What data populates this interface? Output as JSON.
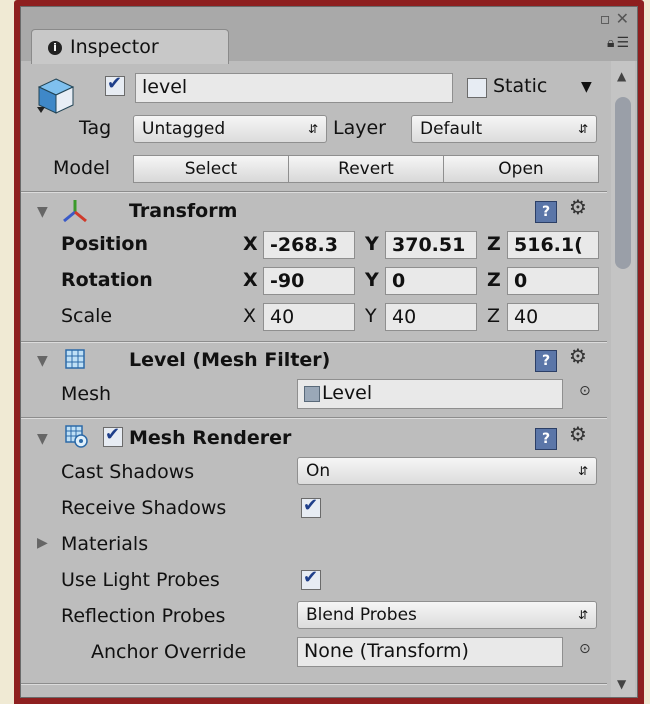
{
  "window": {
    "tab_title": "Inspector"
  },
  "object": {
    "active": true,
    "name": "level",
    "static_label": "Static",
    "tag_label": "Tag",
    "tag_value": "Untagged",
    "layer_label": "Layer",
    "layer_value": "Default",
    "model_label": "Model",
    "model_buttons": [
      "Select",
      "Revert",
      "Open"
    ]
  },
  "transform": {
    "title": "Transform",
    "rows": [
      {
        "label": "Position",
        "x": "-268.3",
        "y": "370.51",
        "z": "516.1("
      },
      {
        "label": "Rotation",
        "x": "-90",
        "y": "0",
        "z": "0"
      },
      {
        "label": "Scale",
        "x": "40",
        "y": "40",
        "z": "40"
      }
    ],
    "axis": [
      "X",
      "Y",
      "Z"
    ]
  },
  "mesh_filter": {
    "title": "Level (Mesh Filter)",
    "mesh_label": "Mesh",
    "mesh_value": "Level"
  },
  "mesh_renderer": {
    "title": "Mesh Renderer",
    "cast_shadows_label": "Cast Shadows",
    "cast_shadows_value": "On",
    "receive_shadows_label": "Receive Shadows",
    "materials_label": "Materials",
    "light_probes_label": "Use Light Probes",
    "reflection_probes_label": "Reflection Probes",
    "reflection_probes_value": "Blend Probes",
    "anchor_override_label": "Anchor Override",
    "anchor_override_value": "None (Transform)"
  },
  "icons": {
    "help": "?",
    "gear": "⚙",
    "foldout_open": "▼",
    "foldout_closed": "▶",
    "object_picker": "⊙",
    "dropdown_arrow": "↕"
  }
}
